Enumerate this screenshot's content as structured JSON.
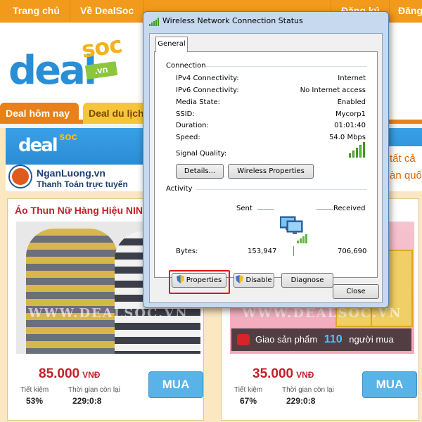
{
  "site": {
    "nav": [
      "Trang chủ",
      "Về DealSoc",
      "Đăng ký",
      "Đăng"
    ],
    "logo": {
      "deal": "deal",
      "soc": "soc",
      "vn": ".vn"
    },
    "tabs": {
      "active": "Deal hôm nay",
      "inactive": "Deal du lịch"
    },
    "promo": {
      "small_logo": "deal",
      "small_soc": "soc",
      "nganluong": "NganLuong.vn",
      "nganluong_sub": "Thanh Toán trực tuyến",
      "right_text_1": "tất cả",
      "right_text_2": "àn quố"
    },
    "products": [
      {
        "title": "Áo Thun Nữ Hàng Hiệu NINO",
        "watermark": "WWW.DEALSOC.VN",
        "price": "85.000",
        "currency": "VNĐ",
        "save_label": "Tiết kiệm",
        "save_value": "53%",
        "time_label": "Thời gian còn lại",
        "time_value": "229:0:8",
        "buy_label": "MUA"
      },
      {
        "title": "",
        "watermark": "WWW.DEALSOC.VN",
        "delivery_text": "Giao sản phẩm",
        "delivery_count": "110",
        "delivery_suffix": "người mua",
        "price": "35.000",
        "currency": "VNĐ",
        "save_label": "Tiết kiệm",
        "save_value": "67%",
        "time_label": "Thời gian còn lại",
        "time_value": "229:0:8",
        "buy_label": "MUA"
      }
    ]
  },
  "dialog": {
    "title": "Wireless Network Connection Status",
    "tab": "General",
    "connection_label": "Connection",
    "rows": [
      {
        "key": "IPv4 Connectivity:",
        "value": "Internet"
      },
      {
        "key": "IPv6 Connectivity:",
        "value": "No Internet access"
      },
      {
        "key": "Media State:",
        "value": "Enabled"
      },
      {
        "key": "SSID:",
        "value": "Mycorp1"
      },
      {
        "key": "Duration:",
        "value": "01:01:40"
      },
      {
        "key": "Speed:",
        "value": "54.0 Mbps"
      }
    ],
    "signal_label": "Signal Quality:",
    "signal_bars": 5,
    "details_button": "Details...",
    "wireless_props_button": "Wireless Properties",
    "activity_label": "Activity",
    "sent_label": "Sent",
    "received_label": "Received",
    "bytes_label": "Bytes:",
    "bytes_sent": "153,947",
    "bytes_received": "706,690",
    "properties_button": "Properties",
    "disable_button": "Disable",
    "diagnose_button": "Diagnose",
    "close_button": "Close",
    "accent_highlight": "#e0101a"
  }
}
